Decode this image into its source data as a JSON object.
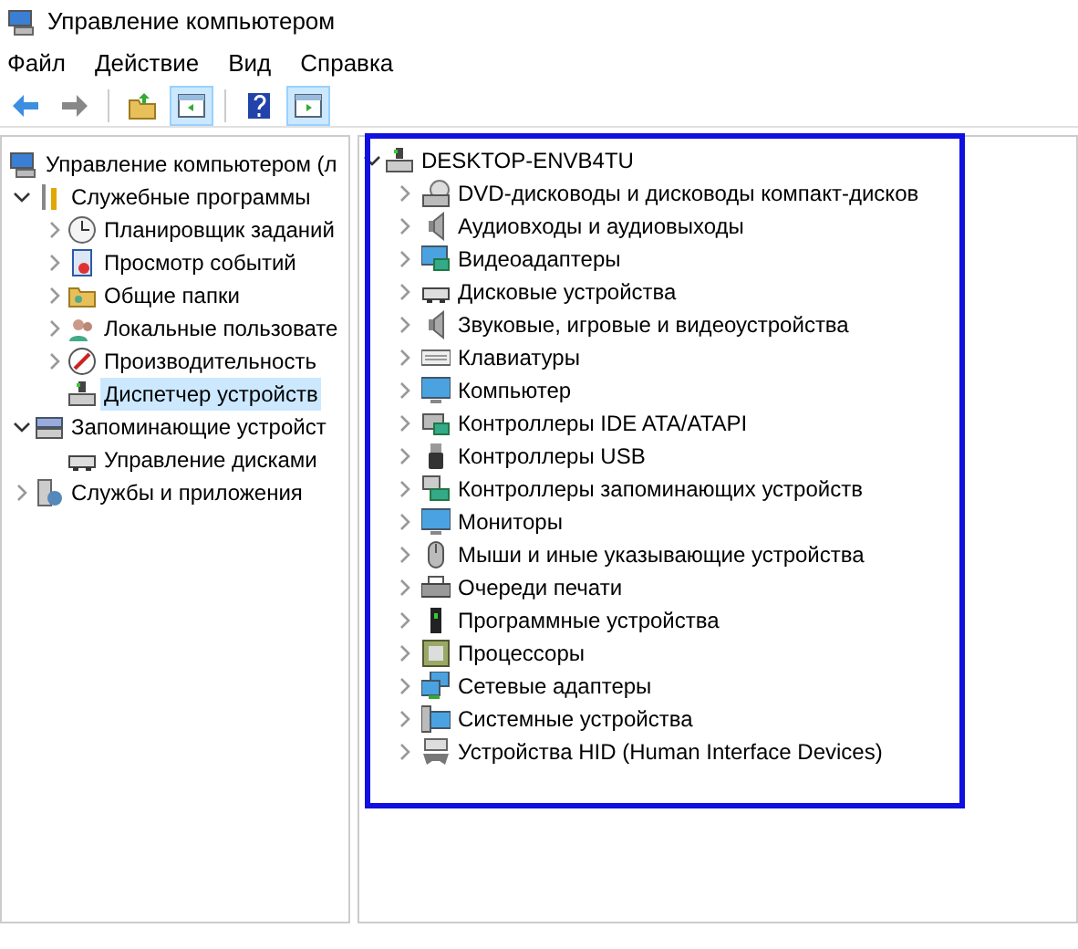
{
  "window": {
    "title": "Управление компьютером"
  },
  "menu": [
    "Файл",
    "Действие",
    "Вид",
    "Справка"
  ],
  "toolbar": [
    {
      "pressed": false
    },
    {
      "pressed": false
    },
    {
      "pressed": false
    },
    {
      "pressed": true
    },
    {
      "pressed": false
    },
    {
      "pressed": true
    }
  ],
  "console_tree": {
    "label": "Управление компьютером (л",
    "selected": false,
    "children": [
      {
        "label": "Служебные программы",
        "expanded": true,
        "selected": false,
        "children": [
          {
            "label": "Планировщик заданий",
            "expanded": false,
            "selected": false
          },
          {
            "label": "Просмотр событий",
            "expanded": false,
            "selected": false
          },
          {
            "label": "Общие папки",
            "expanded": false,
            "selected": false
          },
          {
            "label": "Локальные пользовате",
            "expanded": false,
            "selected": false
          },
          {
            "label": "Производительность",
            "expanded": false,
            "selected": false
          },
          {
            "label": "Диспетчер устройств",
            "selected": true
          }
        ]
      },
      {
        "label": "Запоминающие устройст",
        "expanded": true,
        "selected": false,
        "children": [
          {
            "label": "Управление дисками",
            "selected": false
          }
        ]
      },
      {
        "label": "Службы и приложения",
        "expanded": false,
        "selected": false
      }
    ]
  },
  "device_tree": {
    "label": "DESKTOP-ENVB4TU",
    "expanded": true,
    "children": [
      {
        "label": "DVD-дисководы и дисководы компакт-дисков",
        "expanded": false
      },
      {
        "label": "Аудиовходы и аудиовыходы",
        "expanded": false
      },
      {
        "label": "Видеоадаптеры",
        "expanded": false
      },
      {
        "label": "Дисковые устройства",
        "expanded": false
      },
      {
        "label": "Звуковые, игровые и видеоустройства",
        "expanded": false
      },
      {
        "label": "Клавиатуры",
        "expanded": false
      },
      {
        "label": "Компьютер",
        "expanded": false
      },
      {
        "label": "Контроллеры IDE ATA/ATAPI",
        "expanded": false
      },
      {
        "label": "Контроллеры USB",
        "expanded": false
      },
      {
        "label": "Контроллеры запоминающих устройств",
        "expanded": false
      },
      {
        "label": "Мониторы",
        "expanded": false
      },
      {
        "label": "Мыши и иные указывающие устройства",
        "expanded": false
      },
      {
        "label": "Очереди печати",
        "expanded": false
      },
      {
        "label": "Программные устройства",
        "expanded": false
      },
      {
        "label": "Процессоры",
        "expanded": false
      },
      {
        "label": "Сетевые адаптеры",
        "expanded": false
      },
      {
        "label": "Системные устройства",
        "expanded": false
      },
      {
        "label": "Устройства HID (Human Interface Devices)",
        "expanded": false
      }
    ]
  }
}
